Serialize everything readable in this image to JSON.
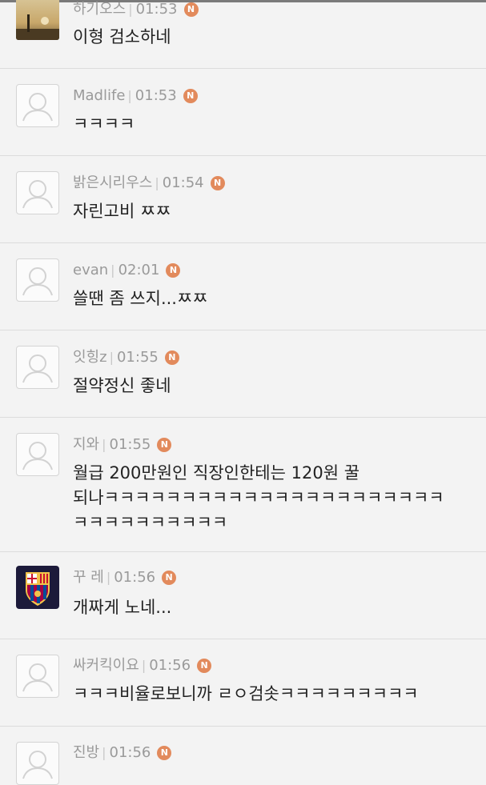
{
  "comments": [
    {
      "user": "하기오스",
      "time": "01:53",
      "badge": "N",
      "text": "이형 검소하네",
      "avatar": "photo-sunset"
    },
    {
      "user": "Madlife",
      "time": "01:53",
      "badge": "N",
      "text": "ㅋㅋㅋㅋ",
      "avatar": "default"
    },
    {
      "user": "밝은시리우스",
      "time": "01:54",
      "badge": "N",
      "text": "자린고비 ㅉㅉ",
      "avatar": "default"
    },
    {
      "user": "evan",
      "time": "02:01",
      "badge": "N",
      "text": "쓸땐 좀 쓰지...ㅉㅉ",
      "avatar": "default"
    },
    {
      "user": "잇힝z",
      "time": "01:55",
      "badge": "N",
      "text": "절약정신 좋네",
      "avatar": "default"
    },
    {
      "user": "지와",
      "time": "01:55",
      "badge": "N",
      "text": "월급 200만원인 직장인한테는 120원 꿀",
      "text2": "되나ㅋㅋㅋㅋㅋㅋㅋㅋㅋㅋㅋㅋㅋㅋㅋㅋㅋㅋㅋㅋㅋㅋ",
      "text3": "ㅋㅋㅋㅋㅋㅋㅋㅋㅋㅋ",
      "avatar": "default"
    },
    {
      "user": "꾸 레",
      "time": "01:56",
      "badge": "N",
      "text": "개짜게 노네...",
      "avatar": "fc-barcelona-crest"
    },
    {
      "user": "싸커킥이요",
      "time": "01:56",
      "badge": "N",
      "text": "ㅋㅋㅋ비율로보니까 ㄹㅇ검솟ㅋㅋㅋㅋㅋㅋㅋㅋㅋ",
      "avatar": "default"
    },
    {
      "user": "진방",
      "time": "01:56",
      "badge": "N",
      "text": "",
      "avatar": "default"
    }
  ]
}
